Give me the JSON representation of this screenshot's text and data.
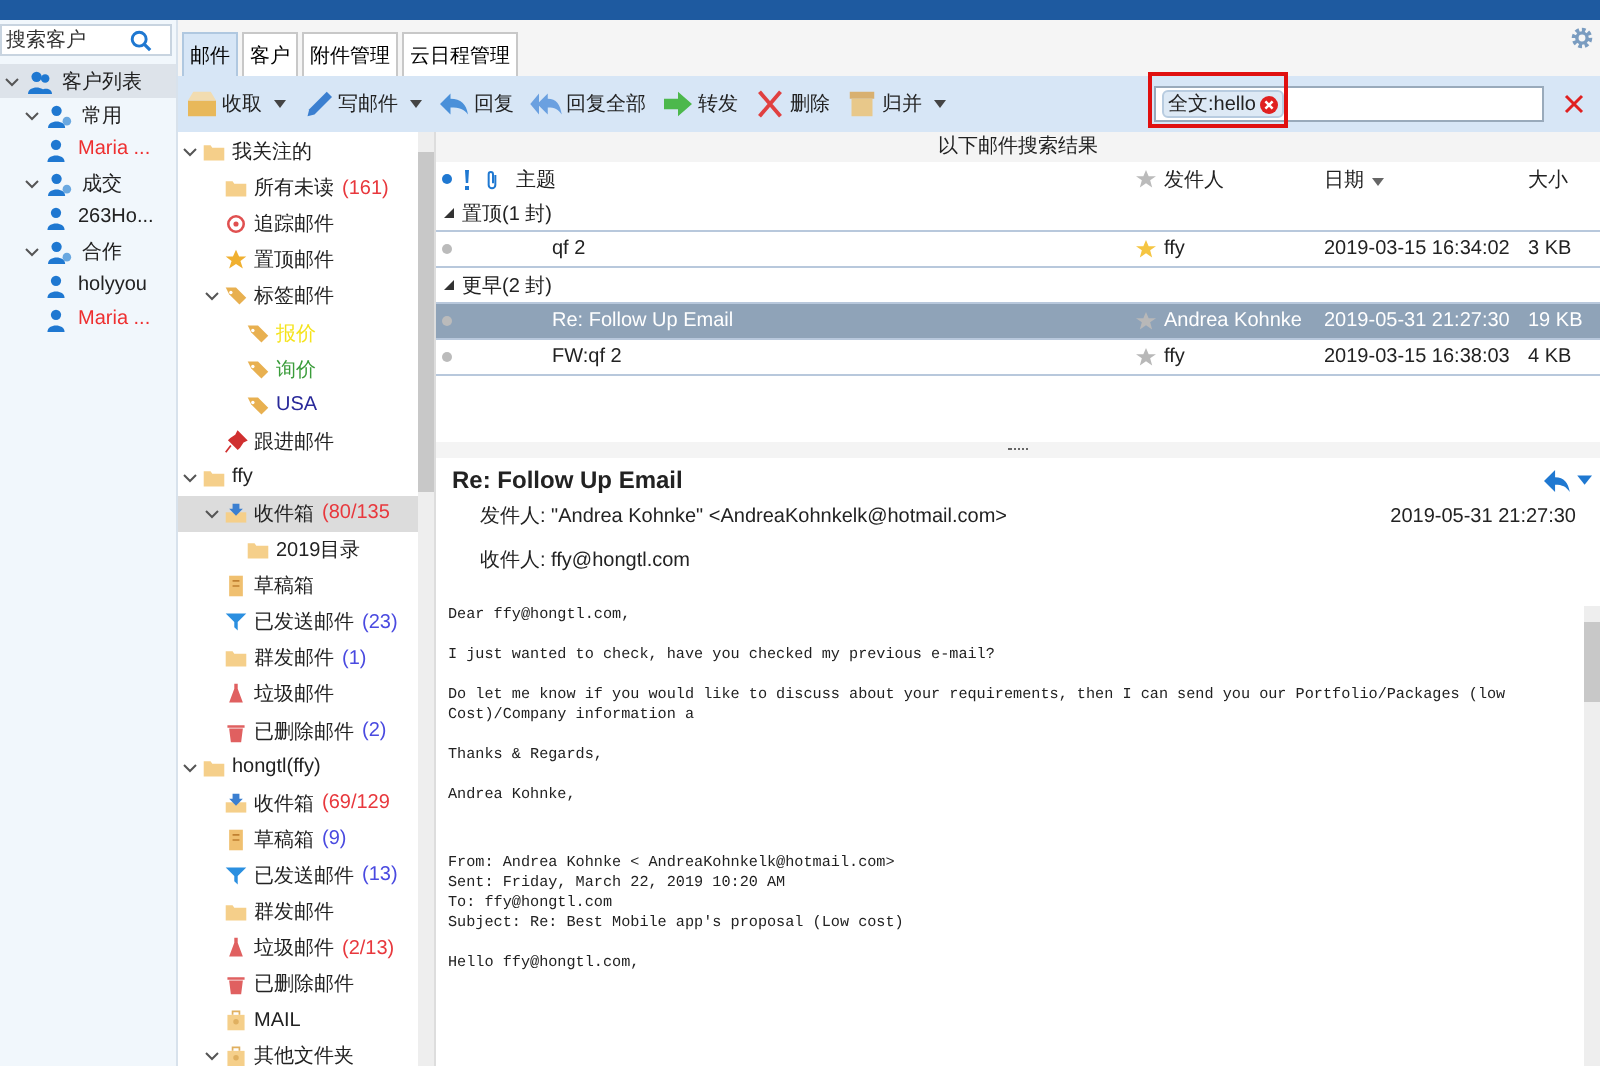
{
  "customers": {
    "search": {
      "placeholder": "搜索客户"
    },
    "tree": [
      {
        "label": "客户列表",
        "kind": "root",
        "expanded": true,
        "selected": true,
        "children": [
          {
            "label": "常用",
            "kind": "group",
            "expanded": true,
            "selected": false,
            "children": [
              {
                "label": "Maria ...",
                "kind": "person",
                "flagged": true,
                "selected": false
              }
            ]
          },
          {
            "label": "成交",
            "kind": "group",
            "expanded": true,
            "selected": false,
            "children": [
              {
                "label": "263Ho...",
                "kind": "person",
                "flagged": false,
                "selected": false
              }
            ]
          },
          {
            "label": "合作",
            "kind": "group",
            "expanded": true,
            "selected": false,
            "children": [
              {
                "label": "holyyou",
                "kind": "person",
                "flagged": false,
                "selected": false
              },
              {
                "label": "Maria ...",
                "kind": "person",
                "flagged": true,
                "selected": false
              }
            ]
          }
        ]
      }
    ]
  },
  "tabs": [
    {
      "label": "邮件",
      "selected": true
    },
    {
      "label": "客户",
      "selected": false
    },
    {
      "label": "附件管理",
      "selected": false
    },
    {
      "label": "云日程管理",
      "selected": false
    }
  ],
  "toolbar": [
    {
      "label": "收取",
      "kind": "receive",
      "has_menu": true
    },
    {
      "label": "写邮件",
      "kind": "compose",
      "has_menu": true
    },
    {
      "label": "回复",
      "kind": "reply",
      "has_menu": false
    },
    {
      "label": "回复全部",
      "kind": "reply-all",
      "has_menu": false
    },
    {
      "label": "转发",
      "kind": "forward",
      "has_menu": false
    },
    {
      "label": "删除",
      "kind": "delete",
      "has_menu": false
    },
    {
      "label": "归并",
      "kind": "archive",
      "has_menu": true
    }
  ],
  "search": {
    "chip": "全文:hello",
    "highlighted": true
  },
  "folders": [
    {
      "label": "我关注的",
      "kind": "folder",
      "expanded": true,
      "selected": false,
      "children": [
        {
          "label": "所有未读",
          "kind": "folder",
          "count": {
            "text": "(161)",
            "kind": "unread"
          },
          "selected": false
        },
        {
          "label": "追踪邮件",
          "kind": "target",
          "selected": false
        },
        {
          "label": "置顶邮件",
          "kind": "star",
          "selected": false
        },
        {
          "label": "标签邮件",
          "kind": "tag",
          "expanded": true,
          "selected": false,
          "children": [
            {
              "label": "报价",
              "kind": "tag",
              "color": "#f5e31a",
              "selected": false
            },
            {
              "label": "询价",
              "kind": "tag",
              "color": "#3a9c3a",
              "selected": false
            },
            {
              "label": "USA",
              "kind": "tag",
              "color": "#2a2a9a",
              "selected": false
            }
          ]
        },
        {
          "label": "跟进邮件",
          "kind": "pin",
          "selected": false
        }
      ]
    },
    {
      "label": "ffy",
      "kind": "folder",
      "expanded": true,
      "selected": false,
      "children": [
        {
          "label": "收件箱",
          "kind": "inbox",
          "count": {
            "text": "(80/135",
            "kind": "unread"
          },
          "expanded": true,
          "selected": true,
          "children": [
            {
              "label": "2019目录",
              "kind": "folder",
              "selected": false
            }
          ]
        },
        {
          "label": "草稿箱",
          "kind": "draft",
          "selected": false
        },
        {
          "label": "已发送邮件",
          "kind": "sent",
          "count": {
            "text": "(23)",
            "kind": "total"
          },
          "selected": false
        },
        {
          "label": "群发邮件",
          "kind": "folder",
          "count": {
            "text": "(1)",
            "kind": "total"
          },
          "selected": false
        },
        {
          "label": "垃圾邮件",
          "kind": "spam",
          "selected": false
        },
        {
          "label": "已删除邮件",
          "kind": "trash",
          "count": {
            "text": "(2)",
            "kind": "total"
          },
          "selected": false
        }
      ]
    },
    {
      "label": "hongtl(ffy)",
      "kind": "folder",
      "expanded": true,
      "selected": false,
      "children": [
        {
          "label": "收件箱",
          "kind": "inbox",
          "count": {
            "text": "(69/129",
            "kind": "unread"
          },
          "selected": false
        },
        {
          "label": "草稿箱",
          "kind": "draft",
          "count": {
            "text": "(9)",
            "kind": "total"
          },
          "selected": false
        },
        {
          "label": "已发送邮件",
          "kind": "sent",
          "count": {
            "text": "(13)",
            "kind": "total"
          },
          "selected": false
        },
        {
          "label": "群发邮件",
          "kind": "folder",
          "selected": false
        },
        {
          "label": "垃圾邮件",
          "kind": "spam",
          "count": {
            "text": "(2/13)",
            "kind": "unread"
          },
          "selected": false
        },
        {
          "label": "已删除邮件",
          "kind": "trash",
          "selected": false
        },
        {
          "label": "MAIL",
          "kind": "box",
          "selected": false
        },
        {
          "label": "其他文件夹",
          "kind": "box",
          "expanded": true,
          "selected": false
        }
      ]
    }
  ],
  "results_label": "以下邮件搜索结果",
  "list": {
    "columns": {
      "subject": "主题",
      "sender": "发件人",
      "date": "日期",
      "size": "大小"
    },
    "groups": [
      {
        "label": "置顶(1 封)",
        "rows": [
          {
            "subject": "qf 2",
            "starred": true,
            "sender": "ffy",
            "date": "2019-03-15 16:34:02",
            "size": "3 KB",
            "selected": false
          }
        ]
      },
      {
        "label": "更早(2 封)",
        "rows": [
          {
            "subject": "Re: Follow Up Email",
            "starred": false,
            "sender": "Andrea Kohnke",
            "date": "2019-05-31 21:27:30",
            "size": "19 KB",
            "selected": true
          },
          {
            "subject": "FW:qf 2",
            "starred": false,
            "sender": "ffy",
            "date": "2019-03-15 16:38:03",
            "size": "4 KB",
            "selected": false
          }
        ]
      }
    ]
  },
  "preview": {
    "title": "Re: Follow Up Email",
    "from_label": "发件人:",
    "from": "\"Andrea Kohnke\" <AndreaKohnkelk@hotmail.com>",
    "to_label": "收件人:",
    "to": "ffy@hongtl.com",
    "date": "2019-05-31 21:27:30",
    "body": [
      {
        "kind": "para",
        "lines": [
          "Dear ffy@hongtl.com,"
        ]
      },
      {
        "kind": "para",
        "lines": [
          "I just wanted to check, have you checked my previous e-mail?"
        ]
      },
      {
        "kind": "para",
        "lines": [
          "Do let me know if you would like to discuss about your requirements, then I can send you our Portfolio/Packages (low Cost)/Company information a"
        ]
      },
      {
        "kind": "para",
        "lines": [
          "Thanks & Regards,"
        ]
      },
      {
        "kind": "para",
        "lines": [
          "Andrea Kohnke,"
        ]
      },
      {
        "kind": "quote",
        "lines": [
          "From: Andrea Kohnke < AndreaKohnkelk@hotmail.com>",
          "Sent: Friday, March 22, 2019 10:20 AM",
          "To: ffy@hongtl.com",
          "Subject: Re: Best Mobile app's proposal (Low cost)"
        ]
      },
      {
        "kind": "para",
        "lines": [
          "Hello ffy@hongtl.com,"
        ]
      }
    ]
  }
}
